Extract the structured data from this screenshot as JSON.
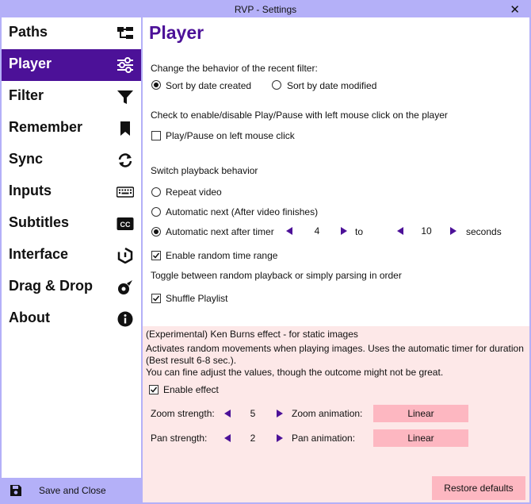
{
  "window": {
    "title": "RVP - Settings",
    "close_glyph": "✕"
  },
  "sidebar": {
    "items": [
      {
        "label": "Paths",
        "icon": "folder-tree-icon"
      },
      {
        "label": "Player",
        "icon": "sliders-icon",
        "active": true
      },
      {
        "label": "Filter",
        "icon": "filter-icon"
      },
      {
        "label": "Remember",
        "icon": "bookmark-icon"
      },
      {
        "label": "Sync",
        "icon": "sync-icon"
      },
      {
        "label": "Inputs",
        "icon": "keyboard-icon"
      },
      {
        "label": "Subtitles",
        "icon": "closed-captions-icon"
      },
      {
        "label": "Interface",
        "icon": "interface-icon"
      },
      {
        "label": "Drag & Drop",
        "icon": "drag-drop-icon"
      },
      {
        "label": "About",
        "icon": "info-icon"
      }
    ],
    "save_label": "Save and Close"
  },
  "player": {
    "title": "Player",
    "recent_filter": {
      "heading": "Change the behavior of the recent filter:",
      "option_created": "Sort by date created",
      "option_modified": "Sort by date modified",
      "selected": "created"
    },
    "click_heading": "Check to enable/disable Play/Pause with left mouse click on the player",
    "click_label": "Play/Pause on left mouse click",
    "click_checked": false,
    "playback": {
      "heading": "Switch playback behavior",
      "repeat": "Repeat video",
      "auto_next": "Automatic next (After video finishes)",
      "auto_timer": "Automatic next after timer",
      "selected": "timer",
      "timer_from": "4",
      "to_label": "to",
      "timer_to": "10",
      "seconds_label": "seconds"
    },
    "random_range_label": "Enable random time range",
    "random_range_checked": true,
    "toggle_heading": "Toggle between random playback or simply parsing in order",
    "shuffle_label": "Shuffle Playlist",
    "shuffle_checked": true
  },
  "ken_burns": {
    "heading": "(Experimental) Ken Burns effect - for static images",
    "desc_line1": "Activates random movements when playing images. Uses the automatic timer for duration",
    "desc_line2": "(Best result 6-8 sec.).",
    "desc_line3": "You can fine adjust the values, though the outcome might not be great.",
    "enable_label": "Enable effect",
    "enable_checked": true,
    "zoom_strength_label": "Zoom strength:",
    "zoom_strength": "5",
    "zoom_animation_label": "Zoom animation:",
    "zoom_animation": "Linear",
    "pan_strength_label": "Pan strength:",
    "pan_strength": "2",
    "pan_animation_label": "Pan animation:",
    "pan_animation": "Linear"
  },
  "restore_label": "Restore defaults",
  "colors": {
    "accent": "#4c1198",
    "frame": "#b4b0f8",
    "ken_bg": "#fde8e8",
    "button": "#fdb7c1"
  }
}
